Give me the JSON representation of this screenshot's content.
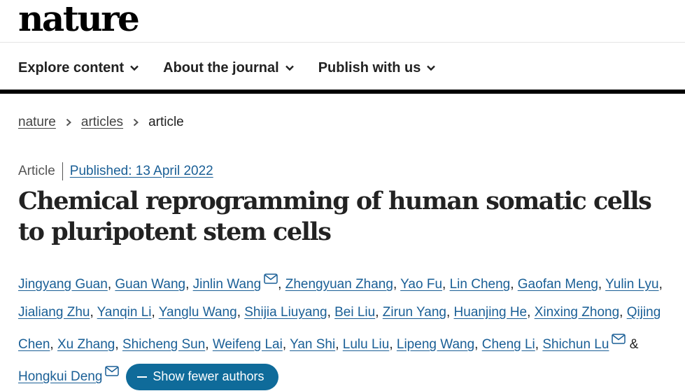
{
  "header": {
    "logo": "nature"
  },
  "nav": [
    {
      "label": "Explore content"
    },
    {
      "label": "About the journal"
    },
    {
      "label": "Publish with us"
    }
  ],
  "breadcrumb": [
    {
      "label": "nature"
    },
    {
      "label": "articles"
    },
    {
      "label": "article"
    }
  ],
  "article": {
    "type": "Article",
    "published": "Published: 13 April 2022",
    "title": "Chemical reprogramming of human somatic cells to pluripotent stem cells"
  },
  "authors": [
    {
      "name": "Jingyang Guan",
      "email": false
    },
    {
      "name": "Guan Wang",
      "email": false
    },
    {
      "name": "Jinlin Wang",
      "email": true
    },
    {
      "name": "Zhengyuan Zhang",
      "email": false
    },
    {
      "name": "Yao Fu",
      "email": false
    },
    {
      "name": "Lin Cheng",
      "email": false
    },
    {
      "name": "Gaofan Meng",
      "email": false
    },
    {
      "name": "Yulin Lyu",
      "email": false
    },
    {
      "name": "Jialiang Zhu",
      "email": false
    },
    {
      "name": "Yanqin Li",
      "email": false
    },
    {
      "name": "Yanglu Wang",
      "email": false
    },
    {
      "name": "Shijia Liuyang",
      "email": false
    },
    {
      "name": "Bei Liu",
      "email": false
    },
    {
      "name": "Zirun Yang",
      "email": false
    },
    {
      "name": "Huanjing He",
      "email": false
    },
    {
      "name": "Xinxing Zhong",
      "email": false
    },
    {
      "name": "Qijing Chen",
      "email": false
    },
    {
      "name": "Xu Zhang",
      "email": false
    },
    {
      "name": "Shicheng Sun",
      "email": false
    },
    {
      "name": "Weifeng Lai",
      "email": false
    },
    {
      "name": "Yan Shi",
      "email": false
    },
    {
      "name": "Lulu Liu",
      "email": false
    },
    {
      "name": "Lipeng Wang",
      "email": false
    },
    {
      "name": "Cheng Li",
      "email": false
    },
    {
      "name": "Shichun Lu",
      "email": true
    },
    {
      "name": "Hongkui Deng",
      "email": true
    }
  ],
  "authors_ui": {
    "separator": ",",
    "last_separator": "&",
    "show_fewer_label": "Show fewer authors"
  },
  "icons": {
    "chevron": "chevron-down-icon",
    "breadcrumb_sep": "chevron-right-icon",
    "email": "mail-icon",
    "minus": "minus-icon"
  },
  "colors": {
    "link": "#1a5f96",
    "button": "#0f6b9a",
    "text": "#222222",
    "bar": "#000000"
  }
}
